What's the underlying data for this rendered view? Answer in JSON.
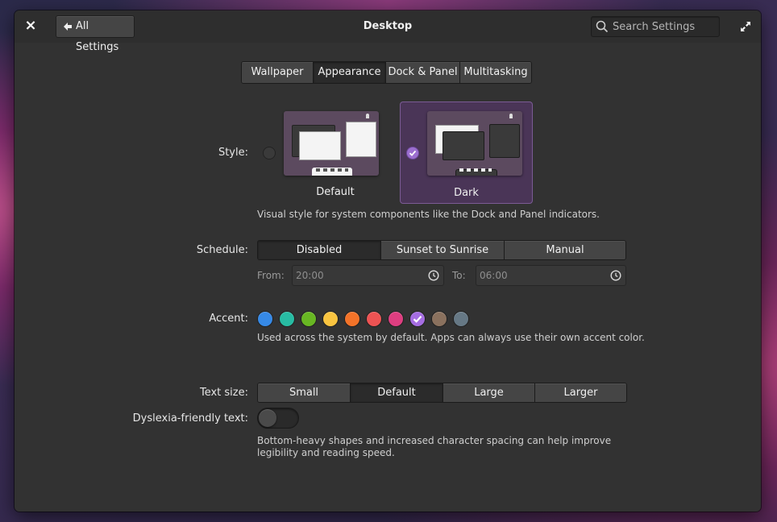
{
  "header": {
    "close_icon": "×",
    "back_label": "All Settings",
    "title": "Desktop",
    "search_placeholder": "Search Settings"
  },
  "tabs": [
    {
      "label": "Wallpaper",
      "active": false
    },
    {
      "label": "Appearance",
      "active": true
    },
    {
      "label": "Dock & Panel",
      "active": false
    },
    {
      "label": "Multitasking",
      "active": false
    }
  ],
  "style": {
    "label": "Style:",
    "options": [
      {
        "name": "Default",
        "selected": false
      },
      {
        "name": "Dark",
        "selected": true
      }
    ],
    "description": "Visual style for system components like the Dock and Panel indicators."
  },
  "schedule": {
    "label": "Schedule:",
    "options": [
      {
        "label": "Disabled",
        "active": true
      },
      {
        "label": "Sunset to Sunrise",
        "active": false
      },
      {
        "label": "Manual",
        "active": false
      }
    ],
    "from_label": "From:",
    "from_value": "20:00",
    "to_label": "To:",
    "to_value": "06:00"
  },
  "accent": {
    "label": "Accent:",
    "colors": [
      {
        "name": "blueberry",
        "hex": "#3689e6",
        "selected": false
      },
      {
        "name": "mint",
        "hex": "#28bca3",
        "selected": false
      },
      {
        "name": "lime",
        "hex": "#68b723",
        "selected": false
      },
      {
        "name": "banana",
        "hex": "#f9c440",
        "selected": false
      },
      {
        "name": "orange",
        "hex": "#f37329",
        "selected": false
      },
      {
        "name": "strawberry",
        "hex": "#ed5353",
        "selected": false
      },
      {
        "name": "bubblegum",
        "hex": "#de3e80",
        "selected": false
      },
      {
        "name": "grape",
        "hex": "#a56de2",
        "selected": true
      },
      {
        "name": "cocoa",
        "hex": "#8a715e",
        "selected": false
      },
      {
        "name": "slate",
        "hex": "#667885",
        "selected": false
      }
    ],
    "description": "Used across the system by default. Apps can always use their own accent color."
  },
  "text_size": {
    "label": "Text size:",
    "options": [
      {
        "label": "Small",
        "active": false
      },
      {
        "label": "Default",
        "active": true
      },
      {
        "label": "Large",
        "active": false
      },
      {
        "label": "Larger",
        "active": false
      }
    ]
  },
  "dyslexia": {
    "label": "Dyslexia-friendly text:",
    "enabled": false,
    "description_line1": "Bottom-heavy shapes and increased character spacing can help improve",
    "description_line2": "legibility and reading speed."
  }
}
